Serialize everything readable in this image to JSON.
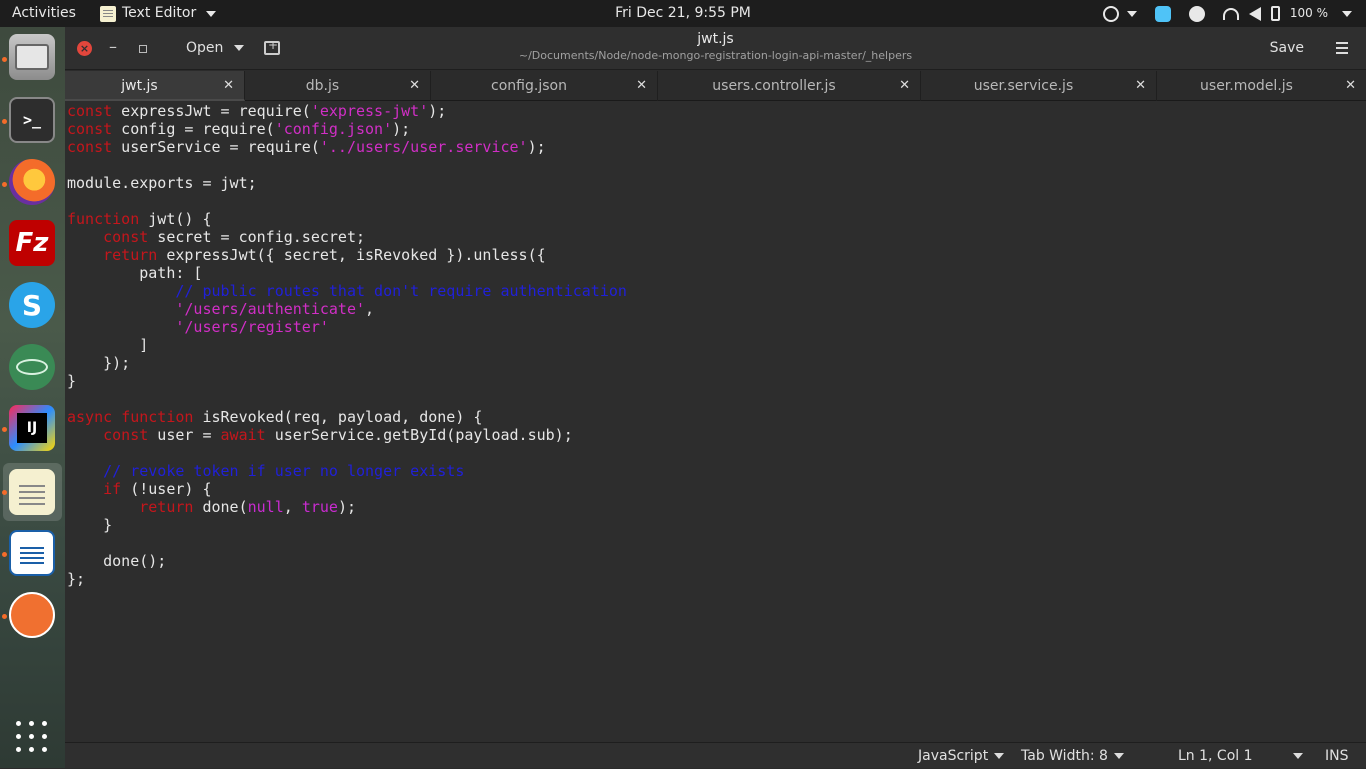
{
  "topbar": {
    "activities": "Activities",
    "app_name": "Text Editor",
    "clock": "Fri Dec 21,  9:55 PM",
    "battery": "100 %"
  },
  "window": {
    "title": "jwt.js",
    "subtitle": "~/Documents/Node/node-mongo-registration-login-api-master/_helpers",
    "open_label": "Open",
    "save_label": "Save"
  },
  "tabs": [
    {
      "label": "jwt.js",
      "active": true
    },
    {
      "label": "db.js",
      "active": false
    },
    {
      "label": "config.json",
      "active": false
    },
    {
      "label": "users.controller.js",
      "active": false
    },
    {
      "label": "user.service.js",
      "active": false
    },
    {
      "label": "user.model.js",
      "active": false
    }
  ],
  "code": [
    [
      [
        "kw",
        "const"
      ],
      [
        "t",
        " expressJwt = require("
      ],
      [
        "str",
        "'express-jwt'"
      ],
      [
        "t",
        ");"
      ]
    ],
    [
      [
        "kw",
        "const"
      ],
      [
        "t",
        " config = require("
      ],
      [
        "str",
        "'config.json'"
      ],
      [
        "t",
        ");"
      ]
    ],
    [
      [
        "kw",
        "const"
      ],
      [
        "t",
        " userService = require("
      ],
      [
        "str",
        "'../users/user.service'"
      ],
      [
        "t",
        ");"
      ]
    ],
    [],
    [
      [
        "t",
        "module.exports = jwt;"
      ]
    ],
    [],
    [
      [
        "kw",
        "function"
      ],
      [
        "t",
        " jwt() {"
      ]
    ],
    [
      [
        "t",
        "    "
      ],
      [
        "kw",
        "const"
      ],
      [
        "t",
        " secret = config.secret;"
      ]
    ],
    [
      [
        "t",
        "    "
      ],
      [
        "kw",
        "return"
      ],
      [
        "t",
        " expressJwt({ secret, isRevoked }).unless({"
      ]
    ],
    [
      [
        "t",
        "        path: ["
      ]
    ],
    [
      [
        "t",
        "            "
      ],
      [
        "cm",
        "// public routes that don't require authentication"
      ]
    ],
    [
      [
        "t",
        "            "
      ],
      [
        "str",
        "'/users/authenticate'"
      ],
      [
        "t",
        ","
      ]
    ],
    [
      [
        "t",
        "            "
      ],
      [
        "str",
        "'/users/register'"
      ]
    ],
    [
      [
        "t",
        "        ]"
      ]
    ],
    [
      [
        "t",
        "    });"
      ]
    ],
    [
      [
        "t",
        "}"
      ]
    ],
    [],
    [
      [
        "kw",
        "async"
      ],
      [
        "t",
        " "
      ],
      [
        "kw",
        "function"
      ],
      [
        "t",
        " isRevoked(req, payload, done) {"
      ]
    ],
    [
      [
        "t",
        "    "
      ],
      [
        "kw",
        "const"
      ],
      [
        "t",
        " user = "
      ],
      [
        "kw",
        "await"
      ],
      [
        "t",
        " userService.getById(payload.sub);"
      ]
    ],
    [],
    [
      [
        "t",
        "    "
      ],
      [
        "cm",
        "// revoke token if user no longer exists"
      ]
    ],
    [
      [
        "t",
        "    "
      ],
      [
        "kw",
        "if"
      ],
      [
        "t",
        " (!user) {"
      ]
    ],
    [
      [
        "t",
        "        "
      ],
      [
        "kw",
        "return"
      ],
      [
        "t",
        " done("
      ],
      [
        "lit",
        "null"
      ],
      [
        "t",
        ", "
      ],
      [
        "lit",
        "true"
      ],
      [
        "t",
        ");"
      ]
    ],
    [
      [
        "t",
        "    }"
      ]
    ],
    [],
    [
      [
        "t",
        "    done();"
      ]
    ],
    [
      [
        "t",
        "};"
      ]
    ]
  ],
  "status": {
    "language": "JavaScript",
    "tab_width": "Tab Width: 8",
    "position": "Ln 1, Col 1",
    "mode": "INS"
  },
  "colors": {
    "keyword": "#c4161c",
    "string": "#d12ec6",
    "comment": "#2020d8",
    "editor_bg": "#2d2d2d"
  },
  "icons": {
    "dock": [
      "files-icon",
      "terminal-icon",
      "firefox-icon",
      "filezilla-icon",
      "skype-icon",
      "atom-icon",
      "intellij-icon",
      "text-editor-icon",
      "writer-icon",
      "postman-icon",
      "app-grid-icon"
    ],
    "tray": [
      "accessibility-icon",
      "skype-tray-icon",
      "sync-icon",
      "wifi-icon",
      "volume-icon",
      "battery-icon"
    ]
  }
}
